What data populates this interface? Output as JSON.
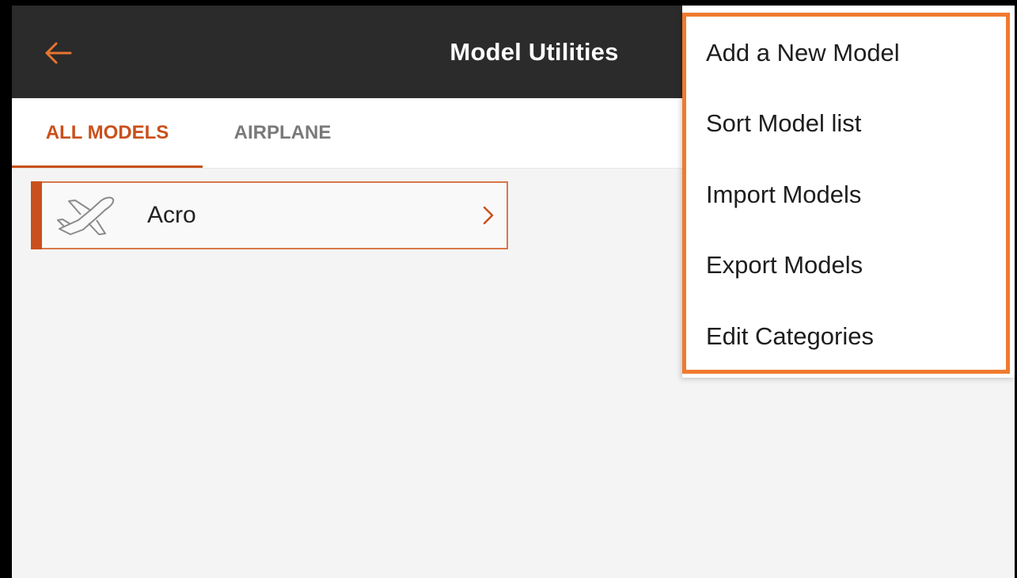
{
  "header": {
    "title": "Model Utilities",
    "back_icon": "arrow-left-icon"
  },
  "tabs": [
    {
      "label": "ALL MODELS",
      "active": true
    },
    {
      "label": "AIRPLANE",
      "active": false
    }
  ],
  "models": [
    {
      "name": "Acro",
      "icon": "airplane-icon",
      "selected": true
    }
  ],
  "menu": {
    "items": [
      {
        "label": "Add a New Model"
      },
      {
        "label": "Sort Model list"
      },
      {
        "label": "Import Models"
      },
      {
        "label": "Export Models"
      },
      {
        "label": "Edit Categories"
      }
    ]
  },
  "colors": {
    "accent": "#c9501c",
    "highlight_outline": "#f07a2e",
    "topbar": "#2b2b2b",
    "background": "#f4f4f4"
  }
}
